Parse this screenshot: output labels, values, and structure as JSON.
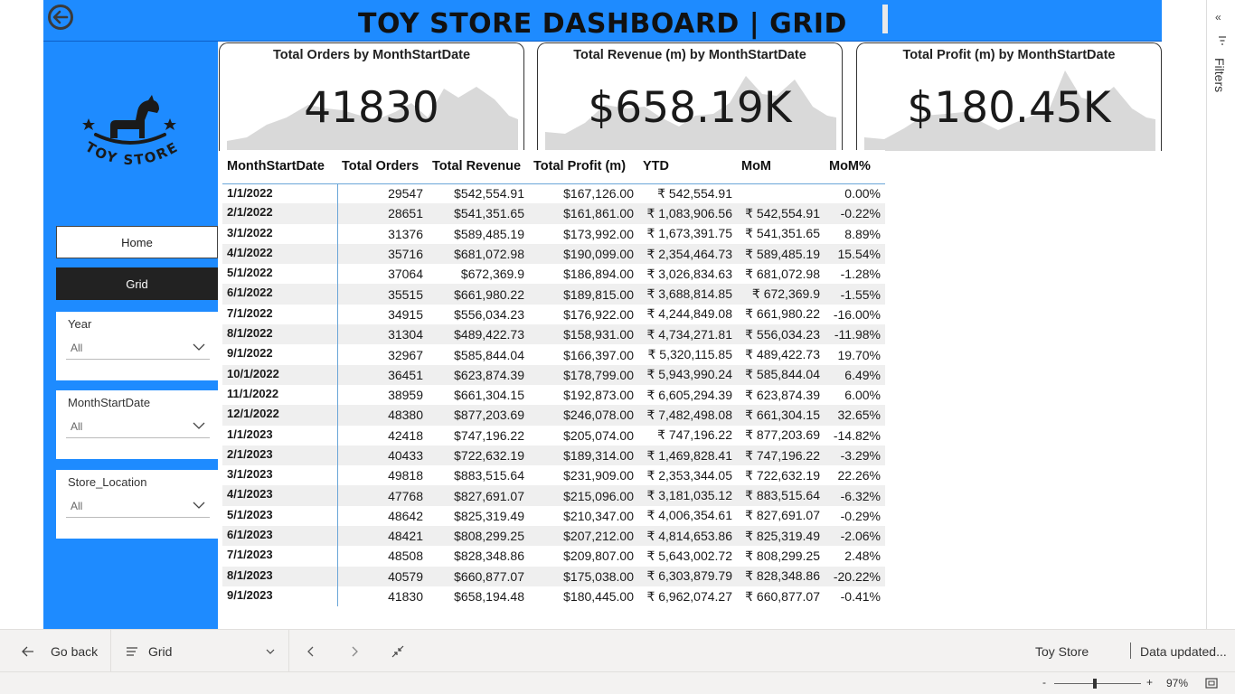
{
  "header": {
    "title": "TOY STORE DASHBOARD | GRID"
  },
  "sidebar": {
    "logo_text": "TOY STORE",
    "nav": {
      "home": "Home",
      "grid": "Grid"
    },
    "slicers": [
      {
        "label": "Year",
        "value": "All"
      },
      {
        "label": "MonthStartDate",
        "value": "All"
      },
      {
        "label": "Store_Location",
        "value": "All"
      }
    ]
  },
  "cards": [
    {
      "title": "Total Orders by MonthStartDate",
      "value": "41830"
    },
    {
      "title": "Total Revenue (m) by MonthStartDate",
      "value": "$658.19K"
    },
    {
      "title": "Total Profit (m) by MonthStartDate",
      "value": "$180.45K"
    }
  ],
  "grid": {
    "columns": [
      "MonthStartDate",
      "Total Orders",
      "Total Revenue",
      "Total Profit (m)",
      "YTD",
      "MoM",
      "MoM%"
    ],
    "rows": [
      [
        "1/1/2022",
        "29547",
        "$542,554.91",
        "$167,126.00",
        "₹ 542,554.91",
        "",
        "0.00%"
      ],
      [
        "2/1/2022",
        "28651",
        "$541,351.65",
        "$161,861.00",
        "₹ 1,083,906.56",
        "₹ 542,554.91",
        "-0.22%"
      ],
      [
        "3/1/2022",
        "31376",
        "$589,485.19",
        "$173,992.00",
        "₹ 1,673,391.75",
        "₹ 541,351.65",
        "8.89%"
      ],
      [
        "4/1/2022",
        "35716",
        "$681,072.98",
        "$190,099.00",
        "₹ 2,354,464.73",
        "₹ 589,485.19",
        "15.54%"
      ],
      [
        "5/1/2022",
        "37064",
        "$672,369.9",
        "$186,894.00",
        "₹ 3,026,834.63",
        "₹ 681,072.98",
        "-1.28%"
      ],
      [
        "6/1/2022",
        "35515",
        "$661,980.22",
        "$189,815.00",
        "₹ 3,688,814.85",
        "₹ 672,369.9",
        "-1.55%"
      ],
      [
        "7/1/2022",
        "34915",
        "$556,034.23",
        "$176,922.00",
        "₹ 4,244,849.08",
        "₹ 661,980.22",
        "-16.00%"
      ],
      [
        "8/1/2022",
        "31304",
        "$489,422.73",
        "$158,931.00",
        "₹ 4,734,271.81",
        "₹ 556,034.23",
        "-11.98%"
      ],
      [
        "9/1/2022",
        "32967",
        "$585,844.04",
        "$166,397.00",
        "₹ 5,320,115.85",
        "₹ 489,422.73",
        "19.70%"
      ],
      [
        "10/1/2022",
        "36451",
        "$623,874.39",
        "$178,799.00",
        "₹ 5,943,990.24",
        "₹ 585,844.04",
        "6.49%"
      ],
      [
        "11/1/2022",
        "38959",
        "$661,304.15",
        "$192,873.00",
        "₹ 6,605,294.39",
        "₹ 623,874.39",
        "6.00%"
      ],
      [
        "12/1/2022",
        "48380",
        "$877,203.69",
        "$246,078.00",
        "₹ 7,482,498.08",
        "₹ 661,304.15",
        "32.65%"
      ],
      [
        "1/1/2023",
        "42418",
        "$747,196.22",
        "$205,074.00",
        "₹ 747,196.22",
        "₹ 877,203.69",
        "-14.82%"
      ],
      [
        "2/1/2023",
        "40433",
        "$722,632.19",
        "$189,314.00",
        "₹ 1,469,828.41",
        "₹ 747,196.22",
        "-3.29%"
      ],
      [
        "3/1/2023",
        "49818",
        "$883,515.64",
        "$231,909.00",
        "₹ 2,353,344.05",
        "₹ 722,632.19",
        "22.26%"
      ],
      [
        "4/1/2023",
        "47768",
        "$827,691.07",
        "$215,096.00",
        "₹ 3,181,035.12",
        "₹ 883,515.64",
        "-6.32%"
      ],
      [
        "5/1/2023",
        "48642",
        "$825,319.49",
        "$210,347.00",
        "₹ 4,006,354.61",
        "₹ 827,691.07",
        "-0.29%"
      ],
      [
        "6/1/2023",
        "48421",
        "$808,299.25",
        "$207,212.00",
        "₹ 4,814,653.86",
        "₹ 825,319.49",
        "-2.06%"
      ],
      [
        "7/1/2023",
        "48508",
        "$828,348.86",
        "$209,807.00",
        "₹ 5,643,002.72",
        "₹ 808,299.25",
        "2.48%"
      ],
      [
        "8/1/2023",
        "40579",
        "$660,877.07",
        "$175,038.00",
        "₹ 6,303,879.79",
        "₹ 828,348.86",
        "-20.22%"
      ],
      [
        "9/1/2023",
        "41830",
        "$658,194.48",
        "$180,445.00",
        "₹ 6,962,074.27",
        "₹ 660,877.07",
        "-0.41%"
      ]
    ]
  },
  "filters": {
    "label": "Filters"
  },
  "bottombar": {
    "go_back": "Go back",
    "page_select": "Grid",
    "report_name": "Toy Store",
    "data_updated": "Data updated..."
  },
  "statusbar": {
    "zoom_minus": "-",
    "zoom_plus": "+",
    "zoom_level": "97%"
  },
  "colors": {
    "accent_blue": "#1e8bff",
    "active_nav": "#222222",
    "sparkline_fill": "#d9d9d9"
  }
}
